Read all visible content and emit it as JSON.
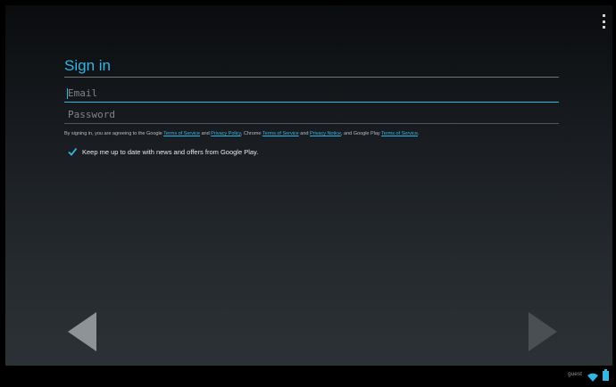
{
  "signin": {
    "title": "Sign in",
    "email_placeholder": "Email",
    "password_placeholder": "Password"
  },
  "terms": {
    "prefix": "By signing in, you are agreeing to the Google ",
    "link1": "Terms of Service",
    "and1": " and ",
    "link2": "Privacy Policy",
    "mid": ", Chrome ",
    "link3": "Terms of Service",
    "and2": " and ",
    "link4": "Privacy Notice",
    "mid2": ", and Google Play ",
    "link5": "Terms of Service",
    "suffix": "."
  },
  "updates": {
    "label": "Keep me up to date with news and offers from Google Play.",
    "checked": true
  },
  "navigation": {
    "back_icon": "arrow-left-icon",
    "next_icon": "arrow-right-icon"
  },
  "status_bar": {
    "user": "guest",
    "wifi_icon": "wifi-icon",
    "battery_icon": "battery-icon"
  },
  "colors": {
    "accent": "#33b5e5",
    "background": "#000000"
  }
}
